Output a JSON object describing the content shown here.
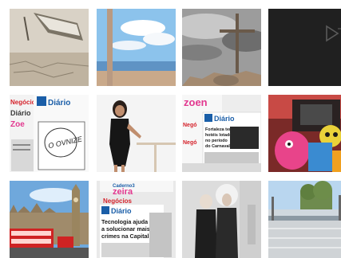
{
  "gallery": {
    "tiles": [
      {
        "name": "boat-dry-lake",
        "type": "image"
      },
      {
        "name": "pole-lake",
        "type": "image"
      },
      {
        "name": "cross-rocks",
        "type": "image"
      },
      {
        "name": "video",
        "type": "video",
        "icon": "play-icon"
      },
      {
        "name": "newspapers-1",
        "type": "image",
        "texts": {
          "brand1": "Negócio",
          "brand2": "Diário",
          "brand3": "Zoe",
          "book": "O OVNIZE"
        }
      },
      {
        "name": "woman-black-dress",
        "type": "image"
      },
      {
        "name": "newspapers-2",
        "type": "image",
        "texts": {
          "zoe": "zoen",
          "brand": "Diário",
          "headline": "Fortaleza terá hotéis lotados no período do Carnaval",
          "neg": "Negó",
          "neg2": "Negó"
        }
      },
      {
        "name": "car-toys",
        "type": "image"
      },
      {
        "name": "london-bus",
        "type": "image"
      },
      {
        "name": "newspapers-3",
        "type": "image",
        "texts": {
          "top": "Caderno3",
          "zoe": "zeira",
          "neg": "Negócios",
          "brand": "Diário",
          "headline": "Tecnologia ajuda a solucionar mais crimes na Capital"
        }
      },
      {
        "name": "couple-awards",
        "type": "image"
      },
      {
        "name": "city-street",
        "type": "image"
      }
    ]
  }
}
